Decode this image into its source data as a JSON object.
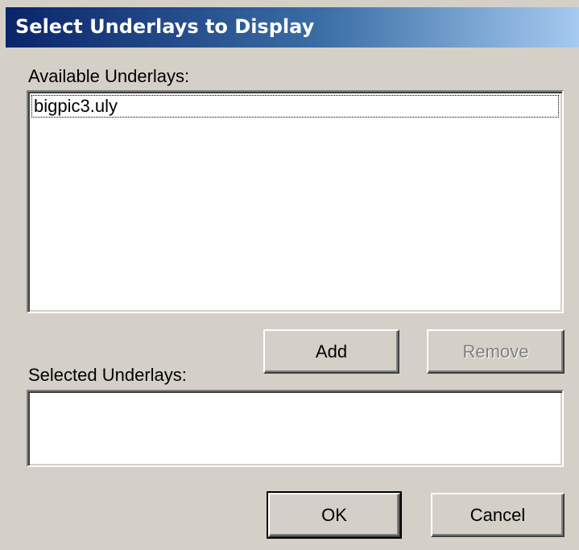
{
  "dialog": {
    "title": "Select Underlays to Display",
    "available_label": "Available Underlays:",
    "available_items": [
      "bigpic3.uly"
    ],
    "selected_label": "Selected Underlays:",
    "selected_items": []
  },
  "buttons": {
    "add": "Add",
    "remove": "Remove",
    "ok": "OK",
    "cancel": "Cancel"
  },
  "colors": {
    "title_gradient_start": "#0a246a",
    "title_gradient_end": "#a6caf0",
    "dialog_face": "#d4d0c8"
  }
}
